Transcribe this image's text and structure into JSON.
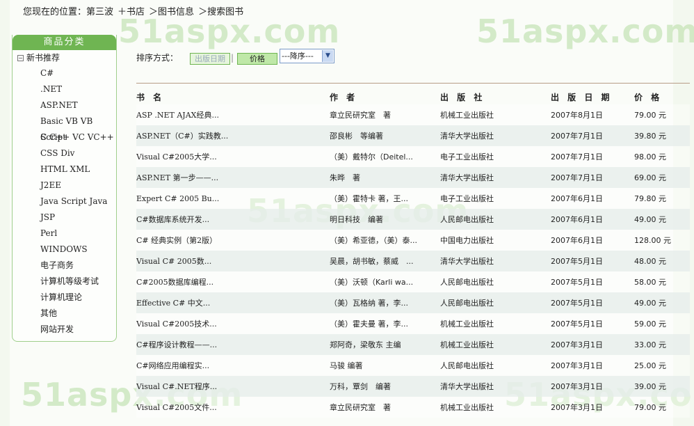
{
  "breadcrumb": {
    "prefix": "您现在的位置：",
    "items": [
      "第三波",
      "＋书店",
      "＞图书信息",
      "＞搜索图书"
    ]
  },
  "watermark_text": "51aspx.com",
  "sidebar": {
    "header": "商品分类",
    "root_toggle": "−",
    "root_label": "新书推荐",
    "items": [
      "C#",
      ".NET",
      "ASP.NET",
      "Basic VB VB Script",
      "C C++ VC VC++",
      "CSS Div",
      "HTML XML",
      "J2EE",
      "Java Script Java",
      "JSP",
      "Perl",
      "WINDOWS",
      "电子商务",
      "计算机等级考试",
      "计算机理论",
      "其他",
      "网站开发"
    ]
  },
  "sort": {
    "label": "排序方式：",
    "date_button": "出版日期",
    "separator": "|",
    "price_button": "价格",
    "order_selected": "---降序---"
  },
  "table": {
    "headers": [
      "书 名",
      "作 者",
      "出 版 社",
      "出 版 日 期",
      "价 格"
    ],
    "rows": [
      [
        "ASP .NET AJAX经典...",
        "章立民研究室　著",
        "机械工业出版社",
        "2007年8月1日",
        "79.00 元"
      ],
      [
        "ASP.NET（C#）实践教...",
        "邵良彬　等编著",
        "清华大学出版社",
        "2007年7月1日",
        "39.80 元"
      ],
      [
        "Visual C#2005大学...",
        "（美）戴特尔（Deitel...",
        "电子工业出版社",
        "2007年7月1日",
        "98.00 元"
      ],
      [
        "ASP.NET 第一步——...",
        "朱晔　著",
        "清华大学出版社",
        "2007年7月1日",
        "69.00 元"
      ],
      [
        "Expert C# 2005 Bu...",
        "（美）霍特卡 著，王...",
        "电子工业出版社",
        "2007年6月1日",
        "79.80 元"
      ],
      [
        "C#数据库系统开发...",
        "明日科技　编著",
        "人民邮电出版社",
        "2007年6月1日",
        "49.00 元"
      ],
      [
        "C# 经典实例（第2版）",
        "（美）希亚德，（美）泰...",
        "中国电力出版社",
        "2007年6月1日",
        "128.00 元"
      ],
      [
        "Visual C# 2005数...",
        "吴晨，胡书敏，蔡威　...",
        "清华大学出版社",
        "2007年5月1日",
        "48.00 元"
      ],
      [
        "C#2005数据库编程...",
        "（美）沃顿（Karli wa...",
        "人民邮电出版社",
        "2007年5月1日",
        "58.00 元"
      ],
      [
        "Effective C# 中文...",
        "（美）瓦格纳 著，李...",
        "人民邮电出版社",
        "2007年5月1日",
        "49.00 元"
      ],
      [
        "Visual C#2005技术...",
        "（美）霍夫曼 著，李...",
        "机械工业出版社",
        "2007年5月1日",
        "59.00 元"
      ],
      [
        "C#程序设计教程——...",
        "郑阿奇，梁敬东 主编",
        "机械工业出版社",
        "2007年3月1日",
        "33.00 元"
      ],
      [
        "C#网络应用编程实...",
        "马骏 编著",
        "人民邮电出版社",
        "2007年3月1日",
        "25.00 元"
      ],
      [
        "Visual C#.NET程序...",
        "万科，覃剑　编著",
        "清华大学出版社",
        "2007年3月1日",
        "39.00 元"
      ],
      [
        "Visual C#2005文件...",
        "章立民研究室　著",
        "机械工业出版社",
        "2007年3月1日",
        "79.00 元"
      ]
    ]
  },
  "colors": {
    "accent_green": "#6fb552",
    "watermark": "#c7e4b8",
    "divider": "#b79c86"
  }
}
